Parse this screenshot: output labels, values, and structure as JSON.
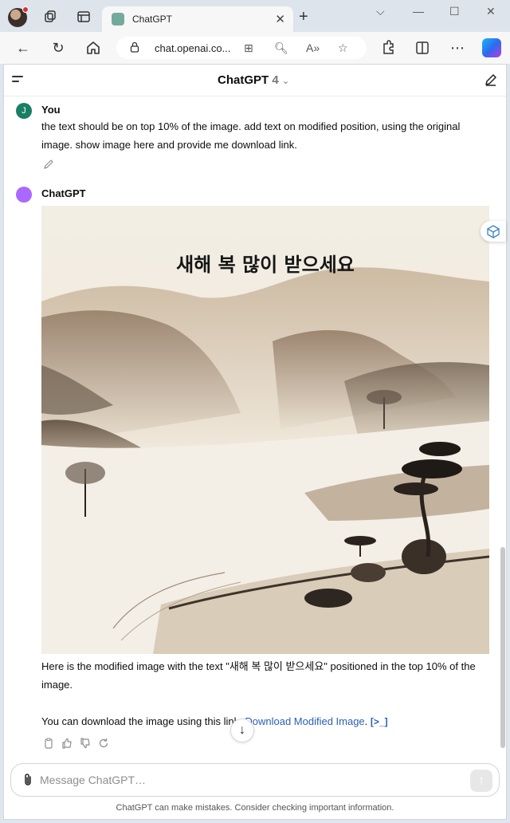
{
  "browser": {
    "tab_title": "ChatGPT",
    "url": "chat.openai.co..."
  },
  "header": {
    "model_name": "ChatGPT",
    "model_version": "4"
  },
  "conversation": {
    "user": {
      "avatar_letter": "J",
      "author": "You",
      "text": "the text should be on top 10% of the image. add text on modified position, using the original image. show image here and provide me download link."
    },
    "assistant": {
      "author": "ChatGPT",
      "image_text": "새해 복 많이 받으세요",
      "p1": "Here is the modified image with the text \"새해 복 많이 받으세요\" positioned in the top 10% of the image.",
      "p2_prefix": "You can download the image using this link: ",
      "p2_link": "Download Modified Image",
      "p2_suffix": "."
    }
  },
  "composer": {
    "placeholder": "Message ChatGPT…"
  },
  "footer": {
    "disclaimer": "ChatGPT can make mistakes. Consider checking important information."
  },
  "colors": {
    "link": "#2b5fb4",
    "user_avatar": "#1a7f64",
    "gpt_avatar": "#ab68ff"
  }
}
